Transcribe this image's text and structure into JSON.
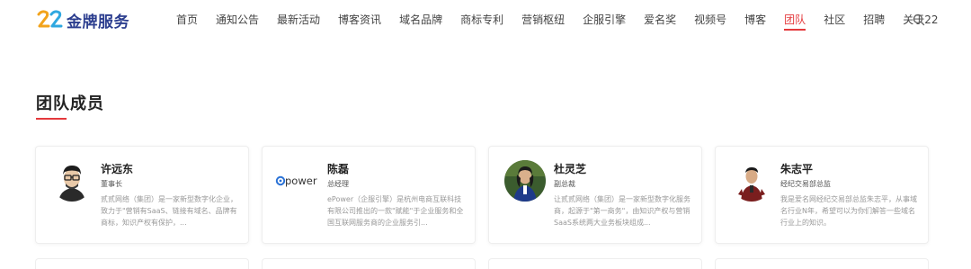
{
  "brand": {
    "logo_text": "金牌服务",
    "accent_color": "#e4393c",
    "brand_color": "#2c3e8f"
  },
  "nav": {
    "items": [
      {
        "label": "首页",
        "active": false
      },
      {
        "label": "通知公告",
        "active": false
      },
      {
        "label": "最新活动",
        "active": false
      },
      {
        "label": "博客资讯",
        "active": false
      },
      {
        "label": "域名品牌",
        "active": false
      },
      {
        "label": "商标专利",
        "active": false
      },
      {
        "label": "营销枢纽",
        "active": false
      },
      {
        "label": "企服引擎",
        "active": false
      },
      {
        "label": "爱名奖",
        "active": false
      },
      {
        "label": "视频号",
        "active": false
      },
      {
        "label": "博客",
        "active": false
      },
      {
        "label": "团队",
        "active": true
      },
      {
        "label": "社区",
        "active": false
      },
      {
        "label": "招聘",
        "active": false
      },
      {
        "label": "关于22",
        "active": false
      }
    ],
    "search_icon": "search-icon"
  },
  "section": {
    "title": "团队成员"
  },
  "members": [
    {
      "name": "许远东",
      "role": "董事长",
      "description": "贰贰网络（集团）是一家新型数字化企业，致力于\"营销有SaaS、链接有域名、品牌有商标，知识产权有保护，...",
      "avatar_icon": "person-avatar"
    },
    {
      "name": "陈磊",
      "role": "总经理",
      "description": "ePower（企服引擎）是杭州电商互联科技有限公司推出的一款\"赋能\"于企业服务和全国互联网服务商的企业服务引...",
      "avatar_logo": "power"
    },
    {
      "name": "杜灵芝",
      "role": "副总裁",
      "description": "让贰贰网络（集团）是一家新型数字化服务商，起源于\"第一商务\"，由知识产权与营销SaaS系统两大业务板块组成...",
      "avatar_icon": "person-avatar"
    },
    {
      "name": "朱志平",
      "role": "经纪交易部总监",
      "description": "我是爱名网经纪交易部总监朱志平，从事域名行业N年，希望可以为你们解答一些域名行业上的知识。",
      "avatar_icon": "person-avatar"
    }
  ]
}
